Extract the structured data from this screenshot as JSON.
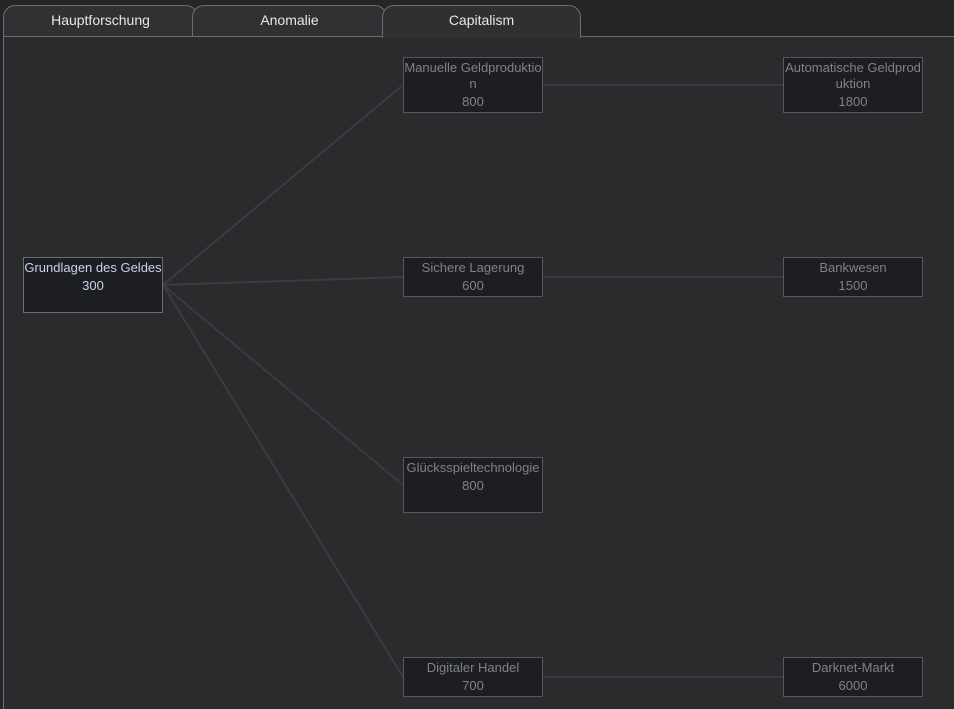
{
  "tabs": [
    {
      "label": "Hauptforschung",
      "active": false
    },
    {
      "label": "Anomalie",
      "active": false
    },
    {
      "label": "Capitalism",
      "active": true
    }
  ],
  "tree": {
    "nodes": {
      "grundlagen": {
        "name": "Grundlagen des Geldes",
        "cost": "300",
        "available": true
      },
      "manuelle": {
        "name": "Manuelle Geldproduktion",
        "cost": "800",
        "available": false
      },
      "sichere": {
        "name": "Sichere Lagerung",
        "cost": "600",
        "available": false
      },
      "gluecksspiel": {
        "name": "Glücksspieltechnologie",
        "cost": "800",
        "available": false
      },
      "digital": {
        "name": "Digitaler Handel",
        "cost": "700",
        "available": false
      },
      "automatische": {
        "name": "Automatische Geldproduktion",
        "cost": "1800",
        "available": false
      },
      "bankwesen": {
        "name": "Bankwesen",
        "cost": "1500",
        "available": false
      },
      "darknet": {
        "name": "Darknet-Markt",
        "cost": "6000",
        "available": false
      }
    },
    "links": [
      [
        "grundlagen",
        "manuelle"
      ],
      [
        "grundlagen",
        "sichere"
      ],
      [
        "grundlagen",
        "gluecksspiel"
      ],
      [
        "grundlagen",
        "digital"
      ],
      [
        "manuelle",
        "automatische"
      ],
      [
        "sichere",
        "bankwesen"
      ],
      [
        "digital",
        "darknet"
      ]
    ]
  },
  "colors": {
    "link": "#3a3c3f",
    "available_text": "#c9d2ea",
    "locked_text": "#808285"
  }
}
